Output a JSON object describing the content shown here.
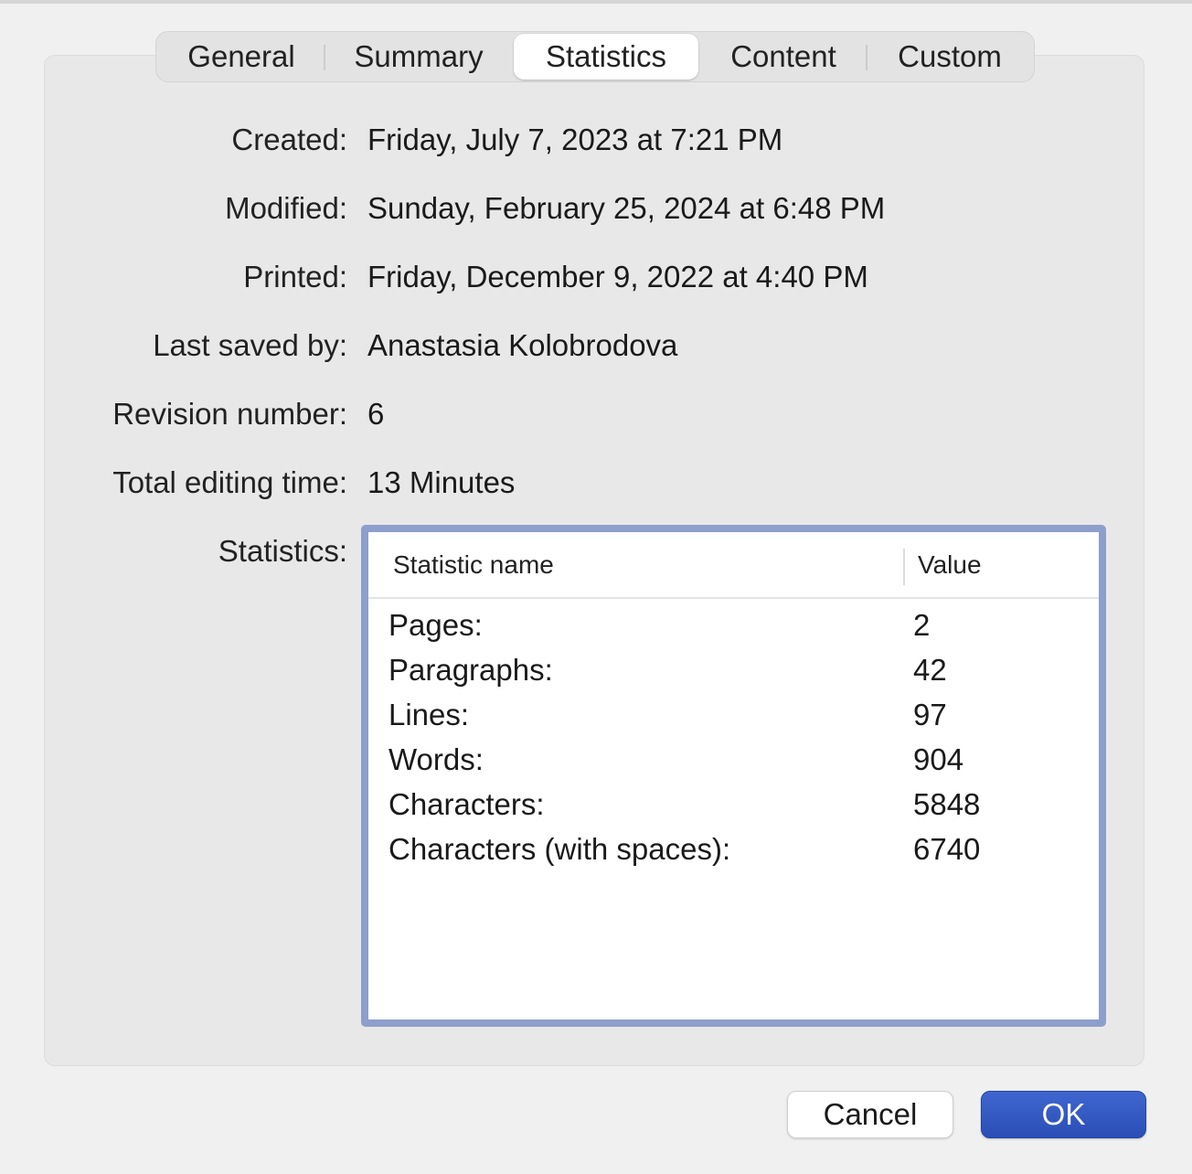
{
  "tabs": [
    {
      "label": "General",
      "active": false
    },
    {
      "label": "Summary",
      "active": false
    },
    {
      "label": "Statistics",
      "active": true
    },
    {
      "label": "Content",
      "active": false
    },
    {
      "label": "Custom",
      "active": false
    }
  ],
  "fields": {
    "created": {
      "label": "Created:",
      "value": "Friday, July 7, 2023 at 7:21 PM"
    },
    "modified": {
      "label": "Modified:",
      "value": "Sunday, February 25, 2024 at 6:48 PM"
    },
    "printed": {
      "label": "Printed:",
      "value": "Friday, December 9, 2022 at 4:40 PM"
    },
    "last_saved_by": {
      "label": "Last saved by:",
      "value": "Anastasia Kolobrodova"
    },
    "revision_number": {
      "label": "Revision number:",
      "value": "6"
    },
    "total_editing_time": {
      "label": "Total editing time:",
      "value": "13 Minutes"
    },
    "statistics": {
      "label": "Statistics:"
    }
  },
  "statistics_table": {
    "columns": [
      "Statistic name",
      "Value"
    ],
    "rows": [
      {
        "name": "Pages:",
        "value": "2"
      },
      {
        "name": "Paragraphs:",
        "value": "42"
      },
      {
        "name": "Lines:",
        "value": "97"
      },
      {
        "name": "Words:",
        "value": "904"
      },
      {
        "name": "Characters:",
        "value": "5848"
      },
      {
        "name": "Characters (with spaces):",
        "value": "6740"
      }
    ]
  },
  "buttons": {
    "cancel": "Cancel",
    "ok": "OK"
  },
  "colors": {
    "accent": "#2f55c0",
    "table_border": "#8d9fcb",
    "panel_background": "#e8e8e8",
    "window_background": "#f0f0f0"
  }
}
